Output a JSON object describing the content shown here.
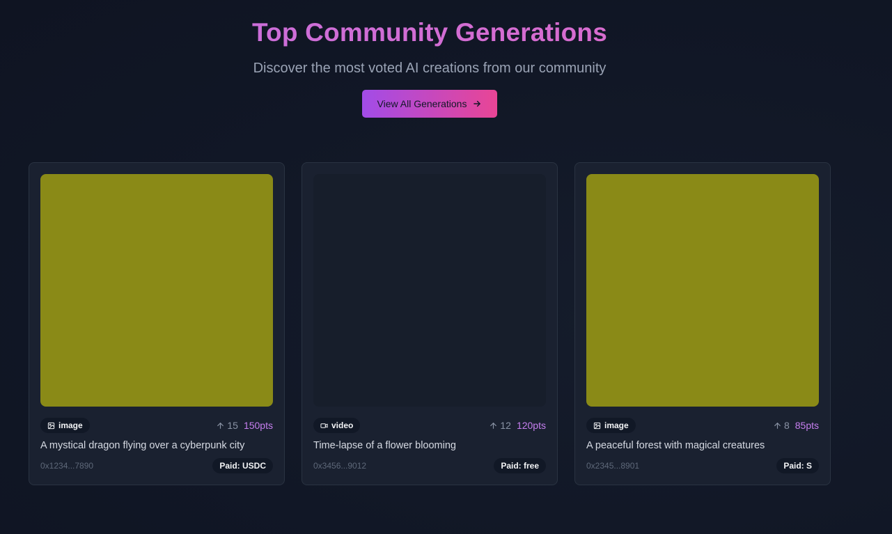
{
  "header": {
    "title": "Top Community Generations",
    "subtitle": "Discover the most voted AI creations from our community",
    "cta_label": "View All Generations"
  },
  "colors": {
    "accent_purple": "#a24ce8",
    "accent_pink": "#e94595",
    "points": "#c77ff0",
    "placeholder_image": "#8a8a17",
    "placeholder_video": "#171e2b"
  },
  "cards": [
    {
      "type": "image",
      "type_icon": "image-icon",
      "votes": "15",
      "points": "150pts",
      "prompt": "A mystical dragon flying over a cyberpunk city",
      "address": "0x1234...7890",
      "paid": "Paid: USDC"
    },
    {
      "type": "video",
      "type_icon": "video-icon",
      "votes": "12",
      "points": "120pts",
      "prompt": "Time-lapse of a flower blooming",
      "address": "0x3456...9012",
      "paid": "Paid: free"
    },
    {
      "type": "image",
      "type_icon": "image-icon",
      "votes": "8",
      "points": "85pts",
      "prompt": "A peaceful forest with magical creatures",
      "address": "0x2345...8901",
      "paid": "Paid: S"
    }
  ]
}
